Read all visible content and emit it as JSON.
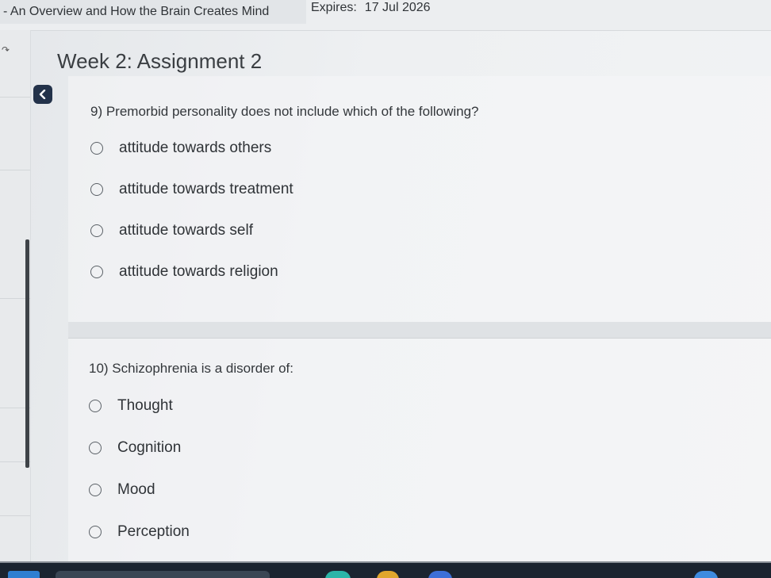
{
  "header": {
    "course_title": "- An Overview and How the Brain Creates Mind",
    "expires_label": "Expires:",
    "expires_date": "17 Jul 2026"
  },
  "page": {
    "title": "Week 2: Assignment 2"
  },
  "icons": {
    "collapse": "chevron-left-icon",
    "gutter": "refresh-icon"
  },
  "questions": [
    {
      "text": "9) Premorbid personality does not include which of the following?",
      "options": [
        "attitude towards others",
        "attitude towards treatment",
        "attitude towards self",
        "attitude towards religion"
      ]
    },
    {
      "text": "10) Schizophrenia is a disorder of:",
      "options": [
        "Thought",
        "Cognition",
        "Mood",
        "Perception"
      ]
    }
  ],
  "colors": {
    "collapse_button": "#23324a",
    "taskbar": "#1b2430"
  }
}
